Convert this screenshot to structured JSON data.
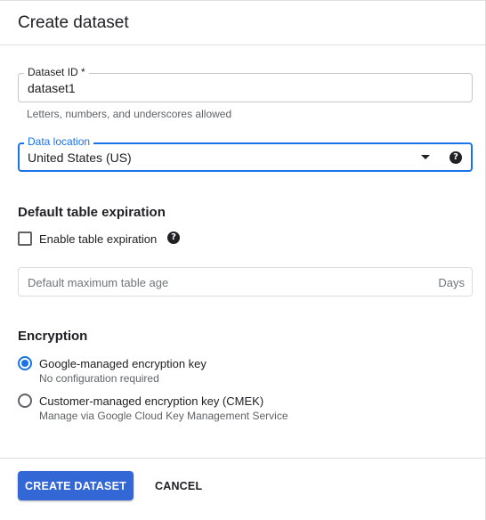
{
  "header": {
    "title": "Create dataset"
  },
  "dataset_id": {
    "label": "Dataset ID *",
    "value": "dataset1",
    "hint": "Letters, numbers, and underscores allowed"
  },
  "data_location": {
    "label": "Data location",
    "value": "United States (US)",
    "icon": "dropdown-arrow-icon",
    "help_icon": "help-icon"
  },
  "expiration": {
    "title": "Default table expiration",
    "checkbox_label": "Enable table expiration",
    "checked": false,
    "max_age_placeholder": "Default maximum table age",
    "suffix": "Days"
  },
  "encryption": {
    "title": "Encryption",
    "options": [
      {
        "label": "Google-managed encryption key",
        "sub": "No configuration required",
        "selected": true
      },
      {
        "label": "Customer-managed encryption key (CMEK)",
        "sub": "Manage via Google Cloud Key Management Service",
        "selected": false
      }
    ]
  },
  "footer": {
    "create_label": "CREATE DATASET",
    "cancel_label": "CANCEL"
  },
  "colors": {
    "accent": "#1a73e8",
    "primary_button": "#3367d6"
  }
}
